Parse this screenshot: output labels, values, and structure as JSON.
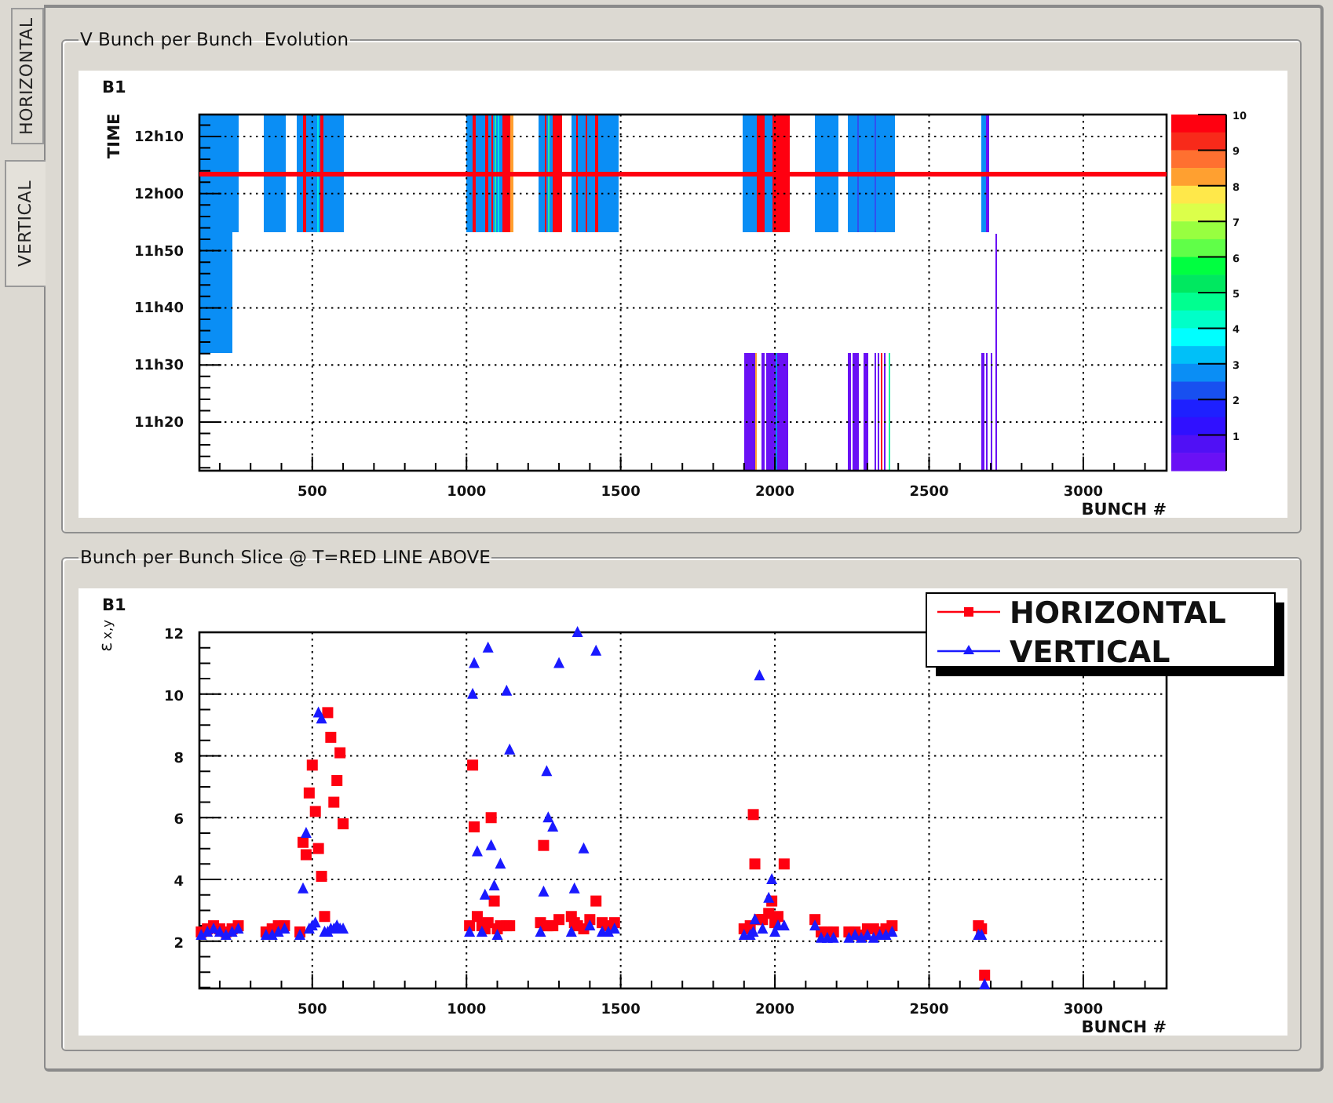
{
  "tabs": [
    {
      "label": "HORIZONTAL",
      "selected": false
    },
    {
      "label": "VERTICAL",
      "selected": true
    }
  ],
  "evolution_panel": {
    "title": "V Bunch per Bunch  Evolution",
    "plot": {
      "label": "B1",
      "ylabel": "TIME",
      "y_tick_labels": [
        "12h10",
        "12h00",
        "11h50",
        "11h40",
        "11h30",
        "11h20"
      ],
      "x_tick_labels": [
        "500",
        "1000",
        "1500",
        "2000",
        "2500",
        "3000"
      ],
      "xlabel": "BUNCH #",
      "colorbar_labels": [
        "10",
        "9",
        "8",
        "7",
        "6",
        "5",
        "4",
        "3",
        "2",
        "1"
      ]
    }
  },
  "slice_panel": {
    "title": "Bunch per Bunch Slice @ T=RED LINE ABOVE",
    "plot": {
      "label": "B1",
      "chart_data": {
        "type": "scatter",
        "grid": true,
        "legend": true,
        "xlabel": "BUNCH #",
        "ylabel": "ε$_{x,y}$",
        "xlim": [
          134,
          3270
        ],
        "ylim": [
          0.47,
          12
        ],
        "xticks": [
          500,
          1000,
          1500,
          2000,
          2500,
          3000
        ],
        "yticks": [
          2,
          4,
          6,
          8,
          10,
          12
        ],
        "x": [
          140,
          160,
          180,
          200,
          220,
          240,
          260,
          350,
          370,
          390,
          410,
          460,
          470,
          480,
          490,
          500,
          510,
          520,
          530,
          540,
          550,
          560,
          570,
          580,
          590,
          600,
          1010,
          1020,
          1025,
          1035,
          1050,
          1060,
          1070,
          1080,
          1090,
          1100,
          1110,
          1130,
          1140,
          1240,
          1250,
          1260,
          1265,
          1280,
          1300,
          1340,
          1350,
          1360,
          1380,
          1400,
          1420,
          1440,
          1460,
          1480,
          1900,
          1920,
          1930,
          1935,
          1950,
          1960,
          1980,
          1990,
          2000,
          2010,
          2030,
          2130,
          2150,
          2170,
          2190,
          2240,
          2260,
          2280,
          2300,
          2320,
          2340,
          2360,
          2380,
          2660,
          2670,
          2680
        ],
        "series": [
          {
            "name": "HORIZONTAL",
            "color": "#ff0010",
            "values": [
              2.3,
              2.4,
              2.5,
              2.4,
              2.3,
              2.4,
              2.5,
              2.3,
              2.4,
              2.5,
              2.5,
              2.3,
              5.2,
              4.8,
              6.8,
              7.7,
              6.2,
              5.0,
              4.1,
              2.8,
              9.4,
              8.6,
              6.5,
              7.2,
              8.1,
              5.8,
              2.5,
              7.7,
              5.7,
              2.8,
              2.5,
              2.4,
              2.6,
              6.0,
              3.3,
              2.4,
              2.5,
              2.5,
              2.5,
              2.6,
              5.1,
              2.5,
              2.5,
              2.5,
              2.7,
              2.8,
              2.6,
              2.5,
              2.4,
              2.7,
              3.3,
              2.6,
              2.5,
              2.6,
              2.4,
              2.5,
              6.1,
              4.5,
              2.7,
              2.7,
              2.9,
              3.3,
              2.6,
              2.8,
              4.5,
              2.7,
              2.3,
              2.3,
              2.3,
              2.3,
              2.3,
              2.2,
              2.4,
              2.4,
              2.3,
              2.4,
              2.5,
              2.5,
              2.4,
              0.9
            ]
          },
          {
            "name": "VERTICAL",
            "color": "#1a1aff",
            "values": [
              2.2,
              2.3,
              2.4,
              2.3,
              2.2,
              2.3,
              2.4,
              2.2,
              2.2,
              2.3,
              2.4,
              2.2,
              3.7,
              5.5,
              2.4,
              2.5,
              2.6,
              9.4,
              9.2,
              2.3,
              2.3,
              2.4,
              2.4,
              2.5,
              2.4,
              2.4,
              2.3,
              10.0,
              11.0,
              4.9,
              2.3,
              3.5,
              11.5,
              5.1,
              3.8,
              2.2,
              4.5,
              10.1,
              8.2,
              2.3,
              3.6,
              7.5,
              6.0,
              5.7,
              11.0,
              2.3,
              3.7,
              12.0,
              5.0,
              2.5,
              11.4,
              2.3,
              2.3,
              2.4,
              2.2,
              2.2,
              2.3,
              2.7,
              10.6,
              2.4,
              3.4,
              4.0,
              2.3,
              2.5,
              2.5,
              2.5,
              2.1,
              2.1,
              2.1,
              2.1,
              2.2,
              2.1,
              2.2,
              2.1,
              2.2,
              2.2,
              2.3,
              2.2,
              2.2,
              0.6
            ]
          }
        ]
      }
    }
  }
}
